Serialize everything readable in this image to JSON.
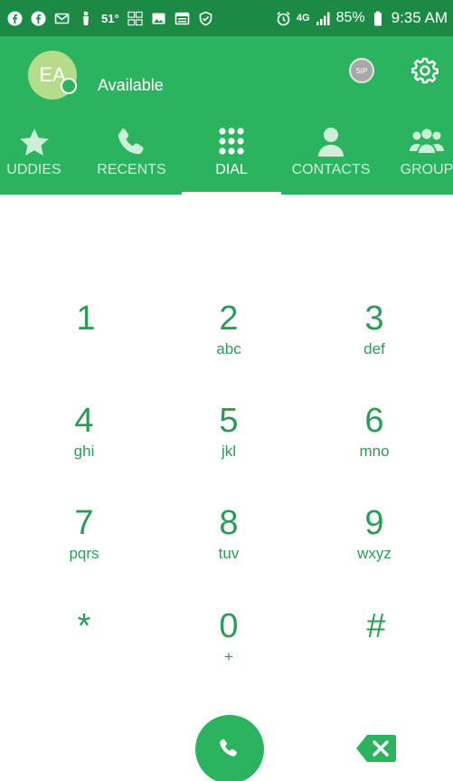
{
  "status_bar": {
    "temperature": "51°",
    "network": "4G",
    "battery": "85%",
    "time": "9:35 AM"
  },
  "profile": {
    "initials": "EA",
    "presence": "Available"
  },
  "sip_label": "SIP",
  "tabs": [
    {
      "label": "UDDIES",
      "icon": "star-icon"
    },
    {
      "label": "RECENTS",
      "icon": "phone-icon"
    },
    {
      "label": "DIAL",
      "icon": "dialpad-icon"
    },
    {
      "label": "CONTACTS",
      "icon": "person-icon"
    },
    {
      "label": "GROUP",
      "icon": "group-icon"
    }
  ],
  "active_tab": "DIAL",
  "keys": [
    {
      "digit": "1",
      "letters": ""
    },
    {
      "digit": "2",
      "letters": "abc"
    },
    {
      "digit": "3",
      "letters": "def"
    },
    {
      "digit": "4",
      "letters": "ghi"
    },
    {
      "digit": "5",
      "letters": "jkl"
    },
    {
      "digit": "6",
      "letters": "mno"
    },
    {
      "digit": "7",
      "letters": "pqrs"
    },
    {
      "digit": "8",
      "letters": "tuv"
    },
    {
      "digit": "9",
      "letters": "wxyz"
    },
    {
      "digit": "*",
      "letters": ""
    },
    {
      "digit": "0",
      "letters": "+"
    },
    {
      "digit": "#",
      "letters": ""
    }
  ],
  "colors": {
    "status_bar": "#1c8a45",
    "header": "#2cb35f",
    "accent": "#2a9c55"
  }
}
